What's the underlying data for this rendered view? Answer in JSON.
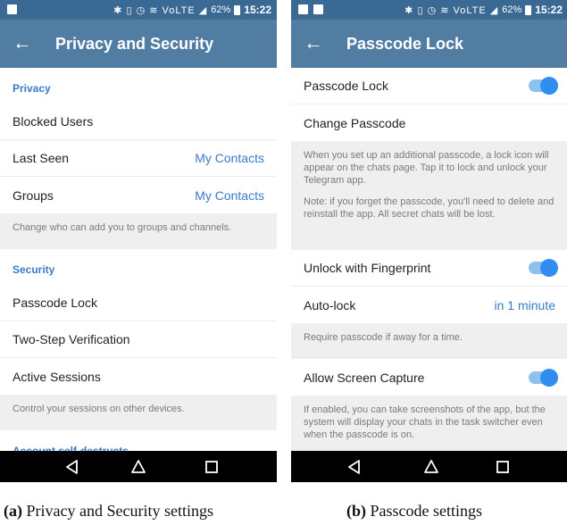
{
  "statusbar": {
    "battery": "62%",
    "time": "15:22",
    "signal_text": "VoLTE"
  },
  "panel_a": {
    "title": "Privacy and Security",
    "privacy_header": "Privacy",
    "privacy_rows": [
      {
        "label": "Blocked Users",
        "value": ""
      },
      {
        "label": "Last Seen",
        "value": "My Contacts"
      },
      {
        "label": "Groups",
        "value": "My Contacts"
      }
    ],
    "privacy_info": "Change who can add you to groups and channels.",
    "security_header": "Security",
    "security_rows": [
      {
        "label": "Passcode Lock"
      },
      {
        "label": "Two-Step Verification"
      },
      {
        "label": "Active Sessions"
      }
    ],
    "security_info": "Control your sessions on other devices.",
    "account_header": "Account self-destructs"
  },
  "panel_b": {
    "title": "Passcode Lock",
    "passcode_lock": {
      "label": "Passcode Lock",
      "enabled": true
    },
    "change_passcode": "Change Passcode",
    "info_1a": "When you set up an additional passcode, a lock icon will appear on the chats page. Tap it to lock and unlock your Telegram app.",
    "info_1b": "Note: if you forget the passcode, you'll need to delete and reinstall the app. All secret chats will be lost.",
    "fingerprint": {
      "label": "Unlock with Fingerprint",
      "enabled": true
    },
    "autolock": {
      "label": "Auto-lock",
      "value": "in 1 minute"
    },
    "info_2": "Require passcode if away for a time.",
    "screen_capture": {
      "label": "Allow Screen Capture",
      "enabled": true
    },
    "info_3": "If enabled, you can take screenshots of the app, but the system will display your chats in the task switcher even when the passcode is on."
  },
  "captions": {
    "a_label": "(a)",
    "a_text": "Privacy and Security settings",
    "b_label": "(b)",
    "b_text": "Passcode settings"
  },
  "colors": {
    "appbar": "#527da3",
    "statusbar": "#3a6a93",
    "accent": "#3a7bc8",
    "toggle": "#2f8ef0"
  },
  "icons": [
    "back-arrow-icon",
    "bluetooth-icon",
    "vibrate-icon",
    "alarm-icon",
    "wifi-icon",
    "signal-icon",
    "battery-icon",
    "nav-back-icon",
    "nav-home-icon",
    "nav-recents-icon"
  ]
}
